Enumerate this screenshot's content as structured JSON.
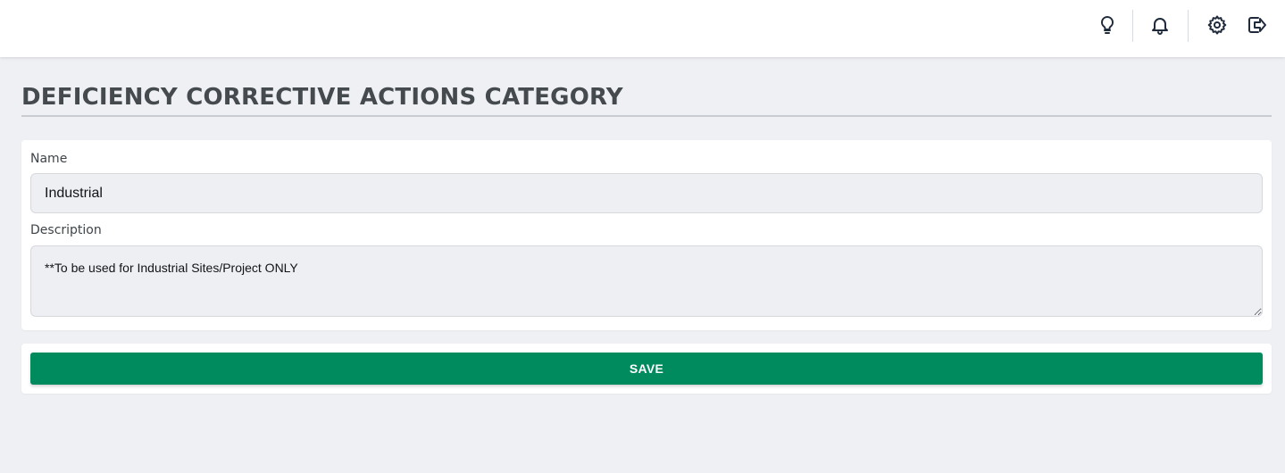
{
  "header": {
    "icons": [
      {
        "name": "lightbulb-icon",
        "label": "tips"
      },
      {
        "name": "bell-icon",
        "label": "notifications"
      },
      {
        "name": "gear-icon",
        "label": "settings"
      },
      {
        "name": "logout-icon",
        "label": "logout"
      }
    ]
  },
  "page": {
    "title": "DEFICIENCY CORRECTIVE ACTIONS CATEGORY"
  },
  "form": {
    "name_label": "Name",
    "name_value": "Industrial",
    "description_label": "Description",
    "description_value": "**To be used for Industrial Sites/Project ONLY"
  },
  "actions": {
    "save_label": "SAVE"
  },
  "colors": {
    "background": "#eff0f4",
    "accent": "#008b5f",
    "title": "#454a4f",
    "input_bg": "#eeeff3"
  }
}
